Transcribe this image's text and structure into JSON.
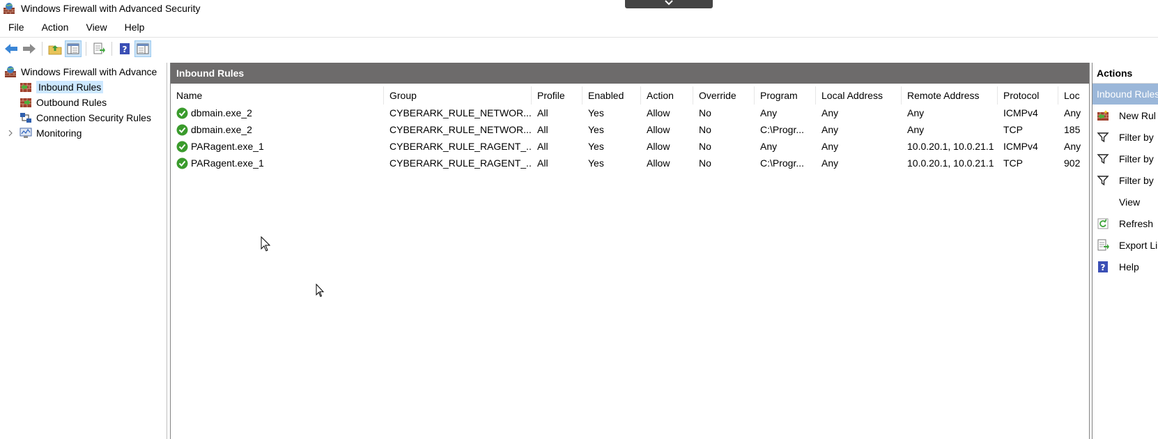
{
  "window": {
    "title": "Windows Firewall with Advanced Security"
  },
  "menu": [
    "File",
    "Action",
    "View",
    "Help"
  ],
  "toolbar": {
    "buttons": [
      "back-icon",
      "forward-icon",
      "up-folder-icon",
      "show-hide-console-tree-icon",
      "export-list-icon",
      "help-icon",
      "show-hide-action-pane-icon"
    ]
  },
  "tree": {
    "root": "Windows Firewall with Advance",
    "items": [
      {
        "label": "Inbound Rules",
        "icon": "inbound-rules-icon",
        "selected": true
      },
      {
        "label": "Outbound Rules",
        "icon": "outbound-rules-icon",
        "selected": false
      },
      {
        "label": "Connection Security Rules",
        "icon": "connection-security-icon",
        "selected": false
      },
      {
        "label": "Monitoring",
        "icon": "monitoring-icon",
        "selected": false
      }
    ]
  },
  "center": {
    "title": "Inbound Rules",
    "columns": [
      "Name",
      "Group",
      "Profile",
      "Enabled",
      "Action",
      "Override",
      "Program",
      "Local Address",
      "Remote Address",
      "Protocol",
      "Loc"
    ],
    "rows": [
      [
        "dbmain.exe_2",
        "CYBERARK_RULE_NETWOR...",
        "All",
        "Yes",
        "Allow",
        "No",
        "Any",
        "Any",
        "Any",
        "ICMPv4",
        "Any"
      ],
      [
        "dbmain.exe_2",
        "CYBERARK_RULE_NETWOR...",
        "All",
        "Yes",
        "Allow",
        "No",
        "C:\\Progr...",
        "Any",
        "Any",
        "TCP",
        "185"
      ],
      [
        "PARagent.exe_1",
        "CYBERARK_RULE_RAGENT_...",
        "All",
        "Yes",
        "Allow",
        "No",
        "Any",
        "Any",
        "10.0.20.1, 10.0.21.1",
        "ICMPv4",
        "Any"
      ],
      [
        "PARagent.exe_1",
        "CYBERARK_RULE_RAGENT_...",
        "All",
        "Yes",
        "Allow",
        "No",
        "C:\\Progr...",
        "Any",
        "10.0.20.1, 10.0.21.1",
        "TCP",
        "902"
      ]
    ]
  },
  "actions": {
    "title": "Actions",
    "section": "Inbound Rules",
    "items": [
      {
        "label": "New Rul",
        "icon": "new-rule-icon"
      },
      {
        "label": "Filter by",
        "icon": "filter-icon"
      },
      {
        "label": "Filter by",
        "icon": "filter-icon"
      },
      {
        "label": "Filter by",
        "icon": "filter-icon"
      },
      {
        "label": "View",
        "icon": ""
      },
      {
        "label": "Refresh",
        "icon": "refresh-icon"
      },
      {
        "label": "Export Li",
        "icon": "export-list-icon"
      },
      {
        "label": "Help",
        "icon": "help-icon"
      }
    ]
  },
  "colors": {
    "header_bar": "#6d6b6b",
    "actions_section": "#9bb7d9",
    "selection": "#cde8ff",
    "check_green": "#3a9b2c"
  }
}
